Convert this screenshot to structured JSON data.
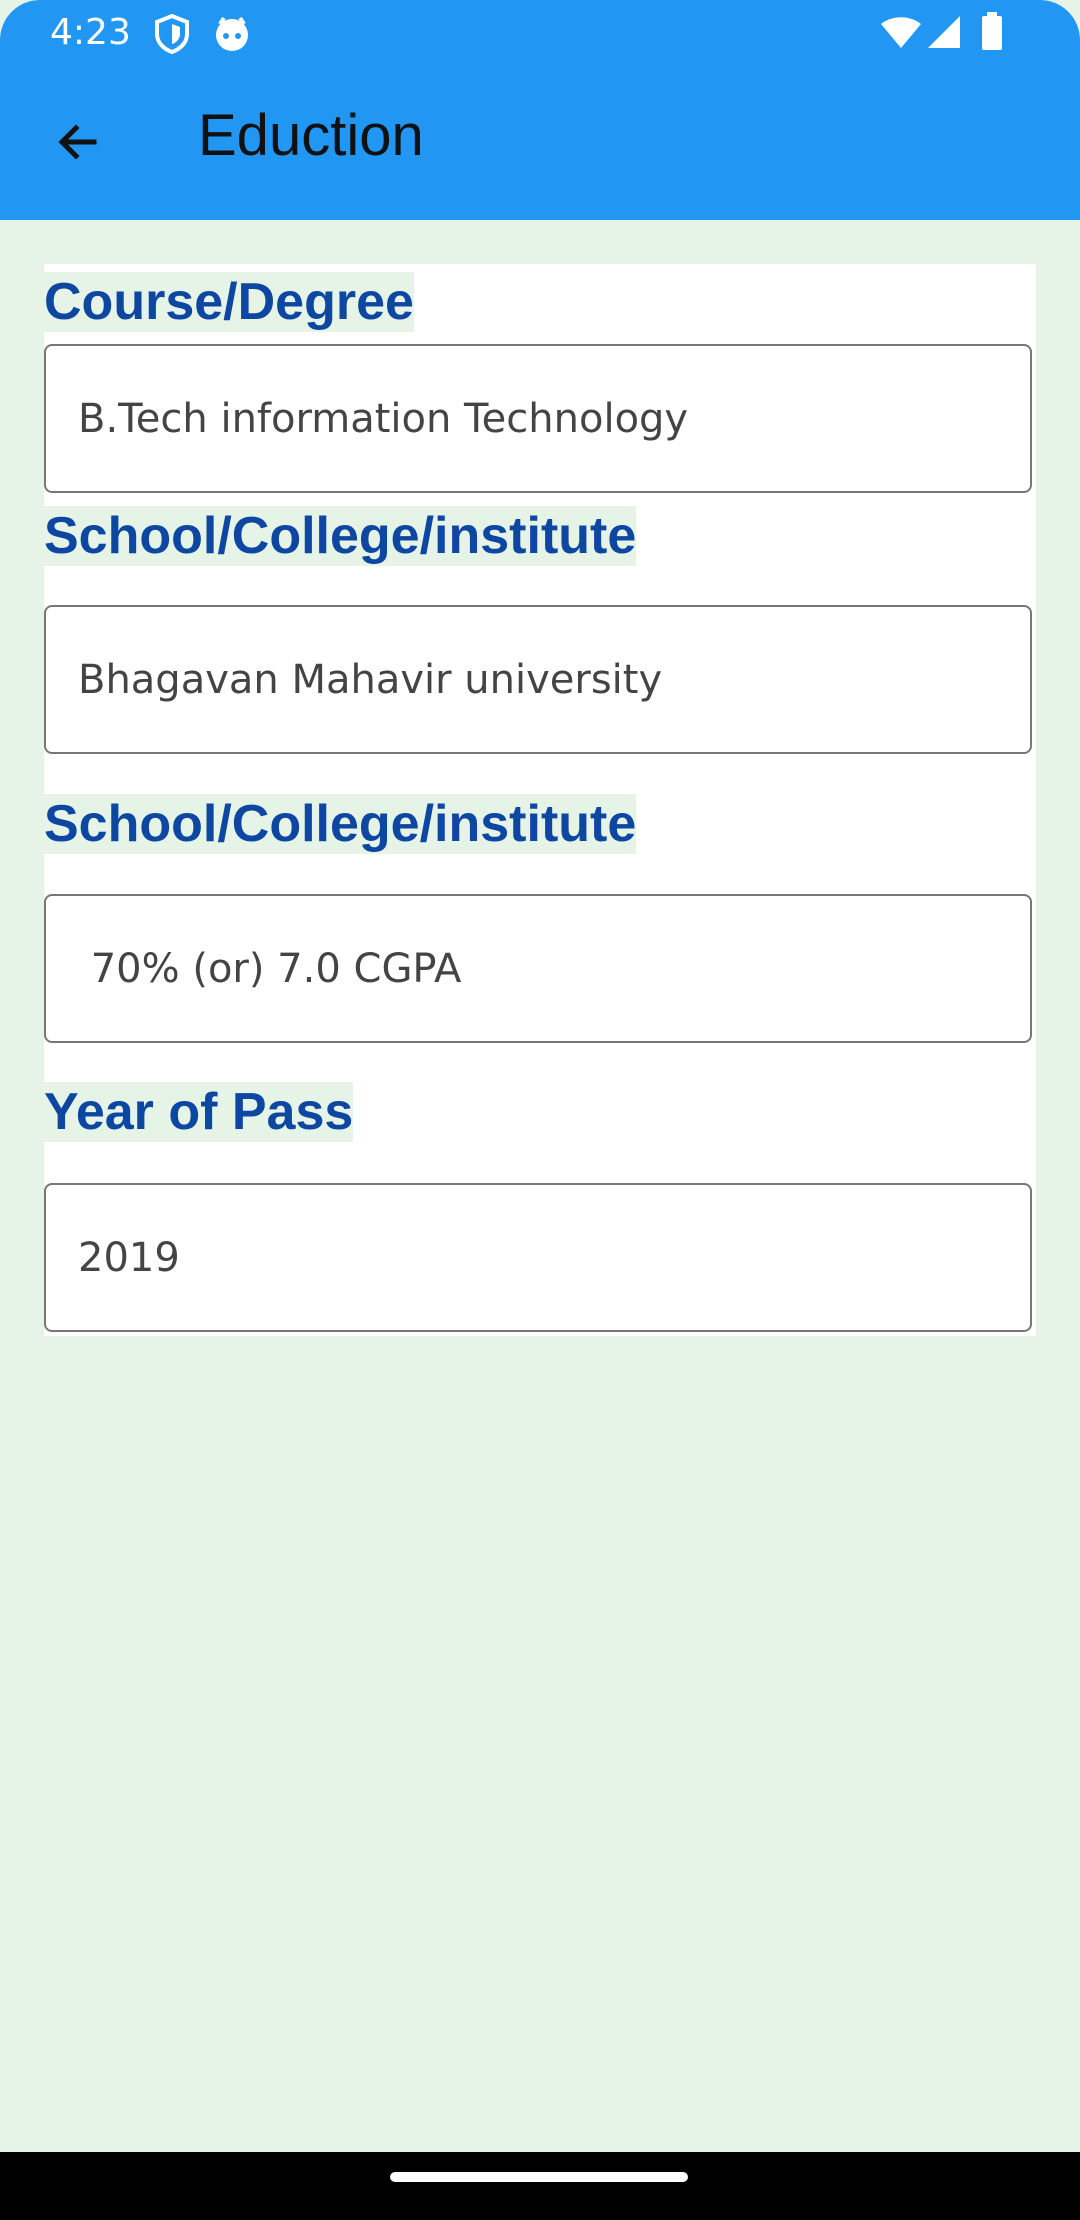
{
  "status_bar": {
    "time": "4:23",
    "icons": [
      "shield-icon",
      "face-icon",
      "wifi-icon",
      "signal-icon",
      "battery-icon"
    ]
  },
  "app_bar": {
    "title": "Eduction",
    "back_icon": "arrow-left-icon",
    "color": "#2196f3"
  },
  "form": {
    "fields": [
      {
        "label": "Course/Degree",
        "value": "B.Tech information Technology"
      },
      {
        "label": "School/College/institute",
        "value": "Bhagavan Mahavir university"
      },
      {
        "label": "School/College/institute",
        "value": " 70% (or) 7.0 CGPA"
      },
      {
        "label": "Year of Pass",
        "value": "2019"
      }
    ]
  },
  "colors": {
    "label": "#0d47a1",
    "background": "#e6f4e7"
  }
}
